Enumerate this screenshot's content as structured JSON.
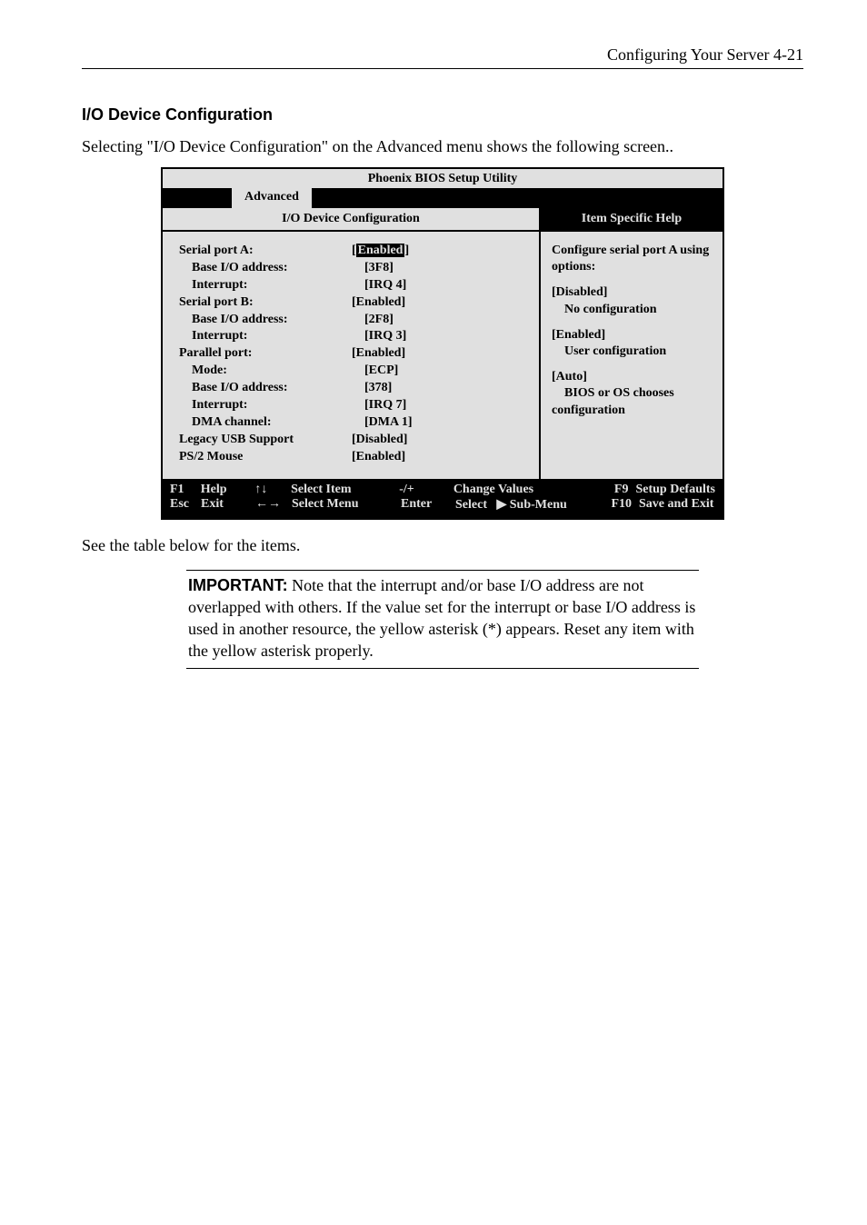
{
  "header": {
    "text": "Configuring Your Server   4-21"
  },
  "section": {
    "title": "I/O Device Configuration"
  },
  "intro": "Selecting \"I/O Device Configuration\" on the Advanced menu shows the following screen..",
  "bios": {
    "title": "Phoenix BIOS Setup Utility",
    "tab": "Advanced",
    "pane_title_left": "I/O Device Configuration",
    "pane_title_right": "Item Specific Help",
    "items": [
      {
        "label": "Serial port A:",
        "value": "Enabled",
        "indent": 0,
        "selected": true
      },
      {
        "label": "Base I/O address:",
        "value": "[3F8]",
        "indent": 1
      },
      {
        "label": "Interrupt:",
        "value": "[IRQ 4]",
        "indent": 1
      },
      {
        "label": "Serial port B:",
        "value": "[Enabled]",
        "indent": 0
      },
      {
        "label": "Base I/O address:",
        "value": "[2F8]",
        "indent": 1
      },
      {
        "label": "Interrupt:",
        "value": "[IRQ 3]",
        "indent": 1
      },
      {
        "label": "Parallel port:",
        "value": "[Enabled]",
        "indent": 0
      },
      {
        "label": "Mode:",
        "value": "[ECP]",
        "indent": 1
      },
      {
        "label": "Base I/O address:",
        "value": "[378]",
        "indent": 1
      },
      {
        "label": "Interrupt:",
        "value": "[IRQ 7]",
        "indent": 1
      },
      {
        "label": "DMA channel:",
        "value": "[DMA 1]",
        "indent": 1
      },
      {
        "label": "",
        "value": "",
        "indent": 0
      },
      {
        "label": "Legacy USB Support",
        "value": "[Disabled]",
        "indent": 0
      },
      {
        "label": "PS/2 Mouse",
        "value": "[Enabled]",
        "indent": 0
      }
    ],
    "help": {
      "l1": "Configure serial port A using options:",
      "l2": "[Disabled]",
      "l3": "No configuration",
      "l4": "[Enabled]",
      "l5": "User configuration",
      "l6": "[Auto]",
      "l7": "BIOS or OS chooses configuration"
    },
    "footer": {
      "r1": {
        "k1": "F1",
        "a1": "Help",
        "k2": "↑↓",
        "a2": "Select Item",
        "k3": "-/+",
        "a3": "Change Values",
        "k4": "F9",
        "a4": "Setup Defaults"
      },
      "r2": {
        "k1": "Esc",
        "a1": "Exit",
        "k2": "←→",
        "a2": "Select Menu",
        "k3": "Enter",
        "a3": "Select   ▶ Sub-Menu",
        "k4": "F10",
        "a4": "Save and Exit"
      }
    }
  },
  "post": "See the table below for the items.",
  "note": {
    "strong": "IMPORTANT:",
    "text": " Note that the interrupt and/or base I/O address are not overlapped with others.   If the value set for the interrupt or base I/O address is used in another resource, the yellow asterisk (*) appears.  Reset any item with the yellow asterisk properly."
  }
}
